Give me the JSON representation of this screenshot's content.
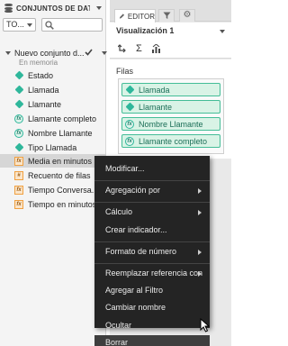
{
  "left_panel": {
    "title": "CONJUNTOS DE DATO...",
    "to_select": "TO...",
    "dataset": {
      "name": "Nuevo conjunto d...",
      "status": "En memoria"
    },
    "fields": [
      {
        "icon": "dimension-icon",
        "label": "Estado"
      },
      {
        "icon": "dimension-icon",
        "label": "Llamada"
      },
      {
        "icon": "dimension-icon",
        "label": "Llamante"
      },
      {
        "icon": "calculated-dimension-icon",
        "label": "Llamante completo"
      },
      {
        "icon": "calculated-dimension-icon",
        "label": "Nombre Llamante"
      },
      {
        "icon": "dimension-icon",
        "label": "Tipo Llamada"
      },
      {
        "icon": "calculated-measure-icon",
        "label": "Media en minutos",
        "selected": true
      },
      {
        "icon": "measure-count-icon",
        "label": "Recuento de filas"
      },
      {
        "icon": "calculated-measure-icon",
        "label": "Tiempo Conversa..."
      },
      {
        "icon": "calculated-measure-icon",
        "label": "Tiempo en minutos"
      }
    ]
  },
  "right_panel": {
    "tabs": {
      "editor": "EDITOR"
    },
    "visualization": "Visualización 1",
    "toolbar_icons": [
      "swap-icon",
      "sigma-icon",
      "sort-icon"
    ],
    "filas_label": "Filas",
    "rows": [
      {
        "icon": "dimension-icon",
        "label": "Llamada"
      },
      {
        "icon": "dimension-icon",
        "label": "Llamante"
      },
      {
        "icon": "calculated-dimension-icon",
        "label": "Nombre Llamante"
      },
      {
        "icon": "calculated-dimension-icon",
        "label": "Llamante completo"
      }
    ]
  },
  "context_menu": {
    "items": [
      {
        "label": "Modificar...",
        "submenu": false
      },
      {
        "separator": true
      },
      {
        "label": "Agregación por",
        "submenu": true
      },
      {
        "separator": true
      },
      {
        "label": "Cálculo",
        "submenu": true
      },
      {
        "label": "Crear indicador...",
        "submenu": false
      },
      {
        "separator": true
      },
      {
        "label": "Formato de número",
        "submenu": true
      },
      {
        "separator": true
      },
      {
        "label": "Reemplazar referencia con",
        "submenu": true
      },
      {
        "label": "Agregar al Filtro",
        "submenu": false
      },
      {
        "label": "Cambiar nombre",
        "submenu": false
      },
      {
        "label": "Ocultar",
        "submenu": false
      },
      {
        "label": "Borrar",
        "submenu": false,
        "hover": true
      }
    ]
  },
  "colors": {
    "accent_green": "#2fb79b",
    "measure_orange": "#f0a040",
    "menu_bg": "#242424"
  }
}
